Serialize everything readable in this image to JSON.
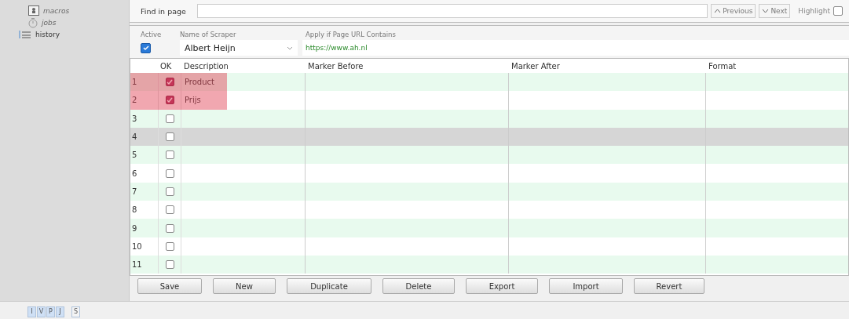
{
  "sidebar": {
    "items": [
      {
        "label": "macros",
        "kind": "macro",
        "disabled": true
      },
      {
        "label": "jobs",
        "kind": "timer",
        "disabled": true
      },
      {
        "label": "history",
        "kind": "list",
        "disabled": false
      }
    ]
  },
  "find_bar": {
    "label": "Find in page",
    "previous": "Previous",
    "next": "Next",
    "highlight": {
      "label": "Highlight",
      "checked": false
    }
  },
  "scraper": {
    "columns": [
      "Active",
      "Name of Scraper",
      "Apply if Page URL Contains"
    ],
    "active": true,
    "name": "Albert Heijn",
    "url": "https://www.ah.nl"
  },
  "table": {
    "columns": [
      "OK",
      "Description",
      "Marker Before",
      "Marker After",
      "Format"
    ],
    "rows": [
      {
        "number": "1",
        "ok": true,
        "description": "Product",
        "selected": false,
        "highlighted": true
      },
      {
        "number": "2",
        "ok": true,
        "description": "Prijs",
        "selected": false,
        "highlighted": true
      },
      {
        "number": "3",
        "ok": false,
        "selected": false,
        "highlighted": false
      },
      {
        "number": "4",
        "ok": false,
        "selected": true,
        "highlighted": false
      },
      {
        "number": "5",
        "ok": false,
        "selected": false,
        "highlighted": false
      },
      {
        "number": "6",
        "ok": false,
        "selected": false,
        "highlighted": false
      },
      {
        "number": "7",
        "ok": false,
        "selected": false,
        "highlighted": false
      },
      {
        "number": "8",
        "ok": false,
        "selected": false,
        "highlighted": false
      },
      {
        "number": "9",
        "ok": false,
        "selected": false,
        "highlighted": false
      },
      {
        "number": "10",
        "ok": false,
        "selected": false,
        "highlighted": false
      },
      {
        "number": "11",
        "ok": false,
        "selected": false,
        "highlighted": false
      }
    ]
  },
  "buttons": [
    "Save",
    "New",
    "Duplicate",
    "Delete",
    "Export",
    "Import",
    "Revert"
  ],
  "status_bar": {
    "buttons": [
      {
        "label": "I",
        "selected": true
      },
      {
        "label": "V",
        "selected": true
      },
      {
        "label": "P",
        "selected": true
      },
      {
        "label": "J",
        "selected": true
      },
      {
        "label": "S",
        "selected": false
      }
    ]
  }
}
